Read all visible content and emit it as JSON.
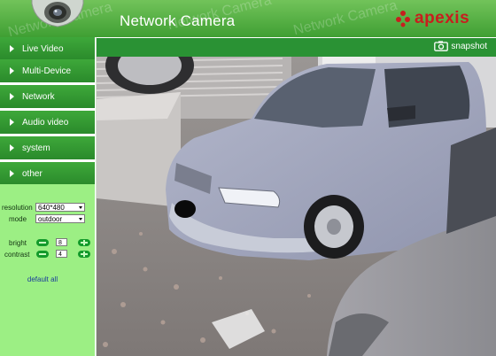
{
  "header": {
    "title": "Network Camera",
    "watermark": "Network Camera",
    "brand": "apexis"
  },
  "sidebar": {
    "items": [
      {
        "label": "Live Video"
      },
      {
        "label": "Multi-Device"
      },
      {
        "label": "Network"
      },
      {
        "label": "Audio video"
      },
      {
        "label": "system"
      },
      {
        "label": "other"
      }
    ]
  },
  "controls": {
    "resolution": {
      "label": "resolution",
      "value": "640*480"
    },
    "mode": {
      "label": "mode",
      "value": "outdoor"
    },
    "bright": {
      "label": "bright",
      "value": "8"
    },
    "contrast": {
      "label": "contrast",
      "value": "4"
    },
    "default_all": "default all"
  },
  "video": {
    "snapshot_label": "snapshot"
  },
  "colors": {
    "header_green": "#3f9f33",
    "nav_green": "#2a8a2b",
    "panel_green": "#9cef84",
    "brand_red": "#c81e1e",
    "link_blue": "#1b3d9a"
  }
}
